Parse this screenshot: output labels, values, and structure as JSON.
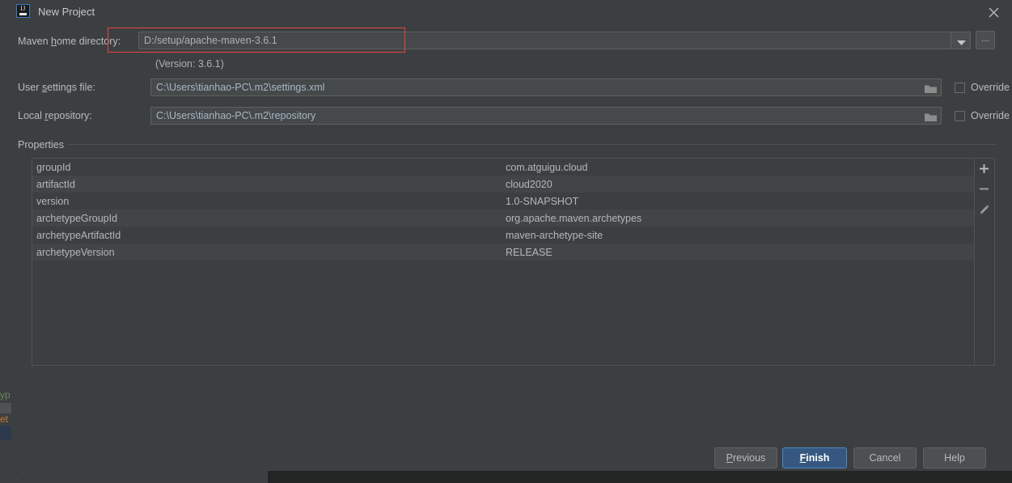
{
  "window": {
    "title": "New Project",
    "app_icon": "intellij-idea-logo-icon",
    "close_icon": "close-icon"
  },
  "form": {
    "maven_home": {
      "label_prefix": "Maven ",
      "label_mnemonic": "h",
      "label_suffix": "ome directory:",
      "value": "D:/setup/apache-maven-3.6.1",
      "dropdown_icon": "chevron-down-icon",
      "browse_label": "...",
      "version_note": "(Version: 3.6.1)"
    },
    "user_settings": {
      "label_prefix": "User ",
      "label_mnemonic": "s",
      "label_suffix": "ettings file:",
      "value": "C:\\Users\\tianhao-PC\\.m2\\settings.xml",
      "folder_icon": "folder-icon",
      "override_label": "Override",
      "override_checked": false
    },
    "local_repository": {
      "label_prefix": "Local ",
      "label_mnemonic": "r",
      "label_suffix": "epository:",
      "value": "C:\\Users\\tianhao-PC\\.m2\\repository",
      "folder_icon": "folder-icon",
      "override_label": "Override",
      "override_checked": false
    }
  },
  "properties": {
    "title": "Properties",
    "rows": [
      {
        "key": "groupId",
        "value": "com.atguigu.cloud"
      },
      {
        "key": "artifactId",
        "value": "cloud2020"
      },
      {
        "key": "version",
        "value": "1.0-SNAPSHOT"
      },
      {
        "key": "archetypeGroupId",
        "value": "org.apache.maven.archetypes"
      },
      {
        "key": "archetypeArtifactId",
        "value": "maven-archetype-site"
      },
      {
        "key": "archetypeVersion",
        "value": "RELEASE"
      }
    ],
    "toolbar": [
      {
        "name": "add-property-button",
        "icon": "plus-icon"
      },
      {
        "name": "remove-property-button",
        "icon": "minus-icon"
      },
      {
        "name": "edit-property-button",
        "icon": "pencil-icon"
      }
    ]
  },
  "footer": {
    "previous": {
      "prefix": "",
      "mnemonic": "P",
      "suffix": "revious"
    },
    "finish": {
      "prefix": "",
      "mnemonic": "F",
      "suffix": "inish"
    },
    "cancel": {
      "prefix": "Cancel",
      "mnemonic": "",
      "suffix": ""
    },
    "help": {
      "prefix": "Help",
      "mnemonic": "",
      "suffix": ""
    }
  },
  "annotation": {
    "highlight_color": "#e8453c"
  },
  "colors": {
    "dialog_background": "#3c3f41",
    "field_background": "#45494a",
    "field_text": "#a9b7c6",
    "default_button": "#365880",
    "default_button_border": "#4a88c7"
  }
}
